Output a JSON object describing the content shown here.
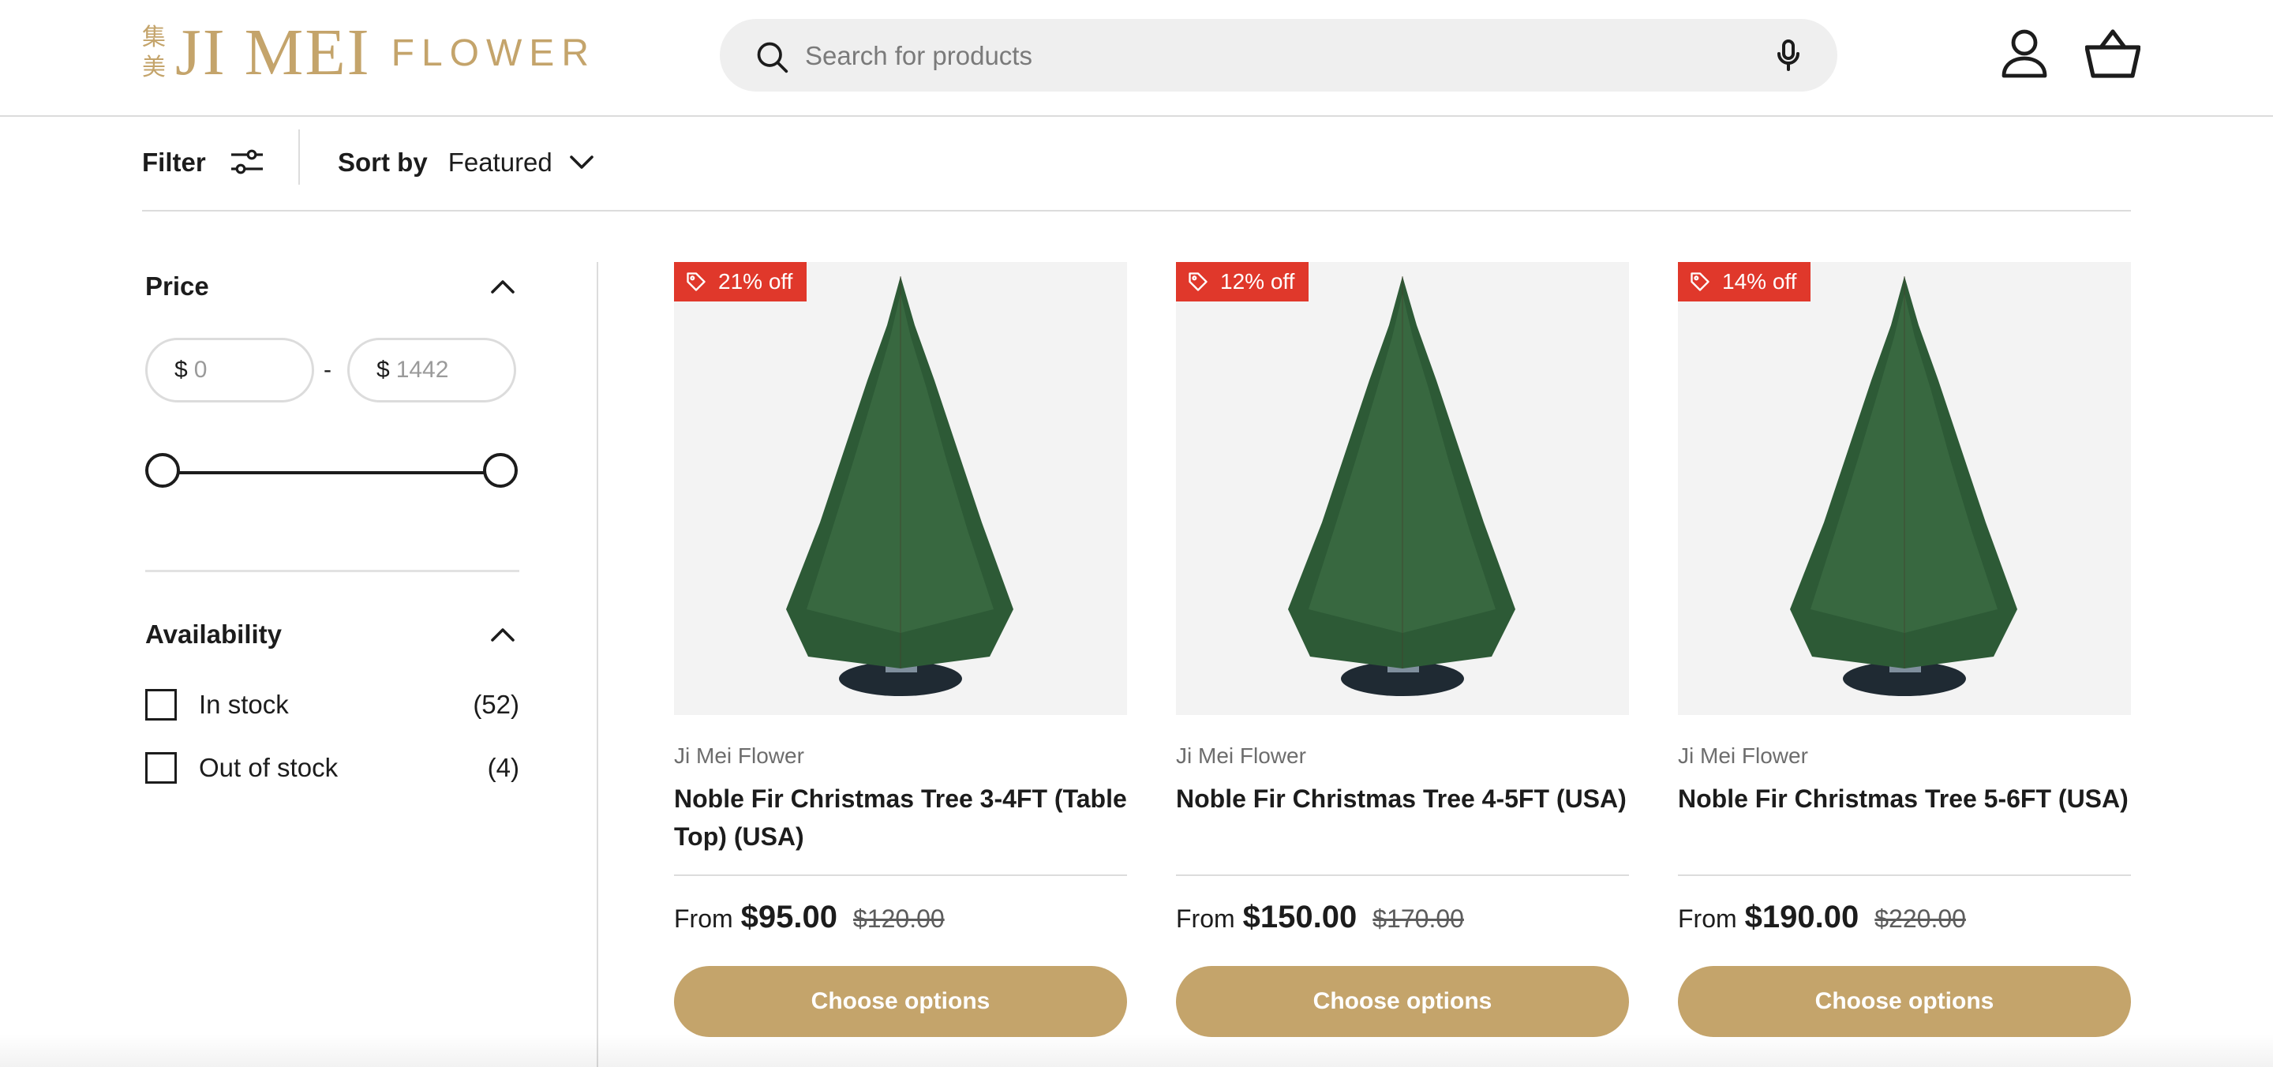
{
  "brand": {
    "cjk_top": "集",
    "cjk_bottom": "美",
    "name": "JI MEI",
    "suffix": "FLOWER",
    "color": "#c4a46b"
  },
  "search": {
    "placeholder": "Search for products",
    "icon": "search-icon",
    "voice_icon": "microphone-icon"
  },
  "header_icons": {
    "account": "user-icon",
    "cart": "basket-icon"
  },
  "toolbar": {
    "filter_label": "Filter",
    "filter_icon": "sliders-icon",
    "sort_label": "Sort by",
    "sort_value": "Featured"
  },
  "filters": {
    "price": {
      "title": "Price",
      "min_currency": "$",
      "min_placeholder": "0",
      "separator": "-",
      "max_currency": "$",
      "max_placeholder": "1442",
      "range": {
        "min": 0,
        "max": 1442,
        "low": 0,
        "high": 1442
      }
    },
    "availability": {
      "title": "Availability",
      "options": [
        {
          "label": "In stock",
          "count": "(52)",
          "checked": false
        },
        {
          "label": "Out of stock",
          "count": "(4)",
          "checked": false
        }
      ]
    }
  },
  "products": [
    {
      "badge": "21% off",
      "vendor": "Ji Mei Flower",
      "title": "Noble Fir Christmas Tree 3-4FT (Table Top) (USA)",
      "from": "From",
      "price": "$95.00",
      "compare_price": "$120.00",
      "button": "Choose options"
    },
    {
      "badge": "12% off",
      "vendor": "Ji Mei Flower",
      "title": "Noble Fir Christmas Tree 4-5FT (USA)",
      "from": "From",
      "price": "$150.00",
      "compare_price": "$170.00",
      "button": "Choose options"
    },
    {
      "badge": "14% off",
      "vendor": "Ji Mei Flower",
      "title": "Noble Fir Christmas Tree 5-6FT (USA)",
      "from": "From",
      "price": "$190.00",
      "compare_price": "$220.00",
      "button": "Choose options"
    }
  ],
  "colors": {
    "accent": "#c4a46b",
    "sale_badge": "#e0382b",
    "text": "#1c1c1c",
    "muted": "#6d6d6d",
    "border": "#dcdcdc"
  }
}
